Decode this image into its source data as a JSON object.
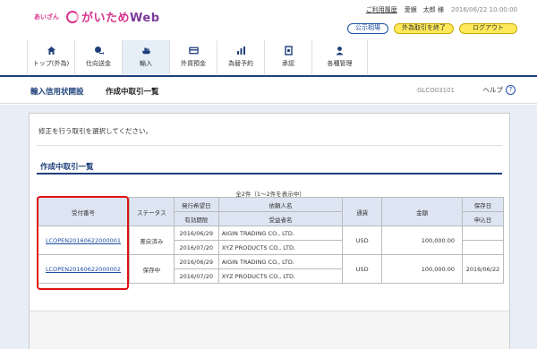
{
  "header": {
    "logo_small": "あいざん",
    "logo_main": "がいため",
    "logo_web": "Web",
    "usage_history": "ご利用履歴",
    "user_name": "愛銀　太郎 様",
    "datetime": "2016/06/22 10:00:00",
    "btn_rates": "公示相場",
    "btn_end_fx": "外為取引を終了",
    "btn_logout": "ログアウト"
  },
  "nav": {
    "items": [
      {
        "label": "トップ(外為)",
        "icon": "home-icon"
      },
      {
        "label": "仕向送金",
        "icon": "remittance-icon"
      },
      {
        "label": "輸入",
        "icon": "import-icon"
      },
      {
        "label": "外貨預金",
        "icon": "deposit-icon"
      },
      {
        "label": "為替予約",
        "icon": "forward-contract-icon"
      },
      {
        "label": "承認",
        "icon": "approval-icon"
      },
      {
        "label": "各種管理",
        "icon": "management-icon"
      }
    ]
  },
  "titlebar": {
    "breadcrumb": "輸入信用状開設",
    "page_title": "作成中取引一覧",
    "screen_id": "GLCO03101",
    "help": "ヘルプ",
    "help_icon": "?"
  },
  "main": {
    "instruction": "修正を行う取引を選択してください。",
    "section_title": "作成中取引一覧",
    "count_text": "全2件（1〜2件を表示中）"
  },
  "table": {
    "headers": {
      "receipt_no": "受付番号",
      "status": "ステータス",
      "issue_date": "発行希望日",
      "expiry": "有効期限",
      "applicant": "依頼人名",
      "beneficiary": "受益者名",
      "currency": "通貨",
      "amount": "金額",
      "saved_date": "保存日",
      "applied_date": "申込日"
    },
    "rows": [
      {
        "receipt_no": "LCOPEN20160622000001",
        "status": "差戻済み",
        "issue_date": "2016/06/29",
        "expiry": "2016/07/20",
        "applicant": "AIGIN TRADING CO., LTD.",
        "beneficiary": "XYZ PRODUCTS CO., LTD.",
        "currency": "USD",
        "amount": "100,000.00",
        "saved_date": "",
        "applied_date": ""
      },
      {
        "receipt_no": "LCOPEN20160622000002",
        "status": "保存中",
        "issue_date": "2016/06/29",
        "expiry": "2016/07/20",
        "applicant": "AIGIN TRADING CO., LTD.",
        "beneficiary": "XYZ PRODUCTS CO., LTD.",
        "currency": "USD",
        "amount": "100,000.00",
        "saved_date": "2016/06/22",
        "applied_date": ""
      }
    ]
  },
  "colors": {
    "brand_pink": "#d9338c",
    "navy": "#1d3f7a",
    "highlight_red": "#e01010",
    "button_yellow": "#ffe95a"
  }
}
